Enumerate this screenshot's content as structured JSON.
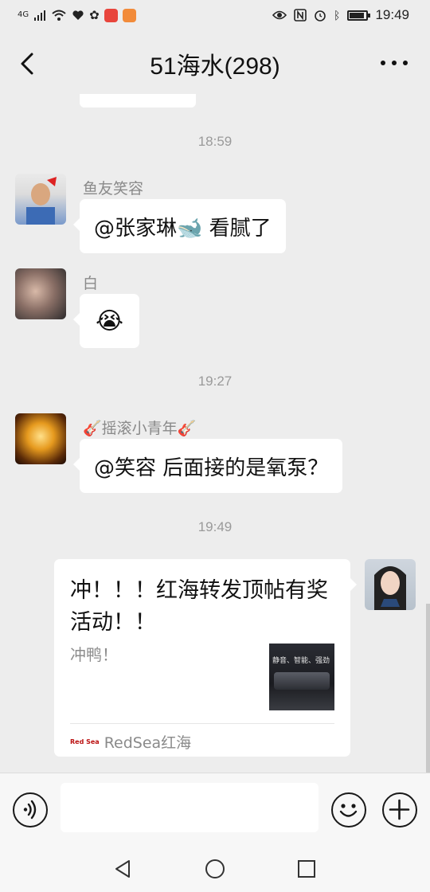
{
  "status_bar": {
    "network": "4G",
    "time": "19:49",
    "battery_level": 0.8
  },
  "nav": {
    "title": "51海水(298)"
  },
  "messages": {
    "time_1": "18:59",
    "msg1": {
      "sender": "鱼友笑容",
      "text": "@张家琳🐋 看腻了"
    },
    "msg2": {
      "sender": "白",
      "text": "😭"
    },
    "time_2": "19:27",
    "msg3": {
      "sender": "🎸摇滚小青年🎸",
      "text": "@笑容  后面接的是氧泵？"
    },
    "time_3": "19:49",
    "card": {
      "title": "冲！！！红海转发顶帖有奖活动！！",
      "description": "冲鸭！",
      "thumb_text": "静音、智能、强劲",
      "source_logo_text": "Red Sea",
      "source": "RedSea红海"
    }
  },
  "input_bar": {
    "message_placeholder": ""
  },
  "icons": {
    "back": "chevron-left-icon",
    "more": "more-icon",
    "voice": "voice-icon",
    "emoji": "emoji-icon",
    "add": "plus-icon"
  }
}
